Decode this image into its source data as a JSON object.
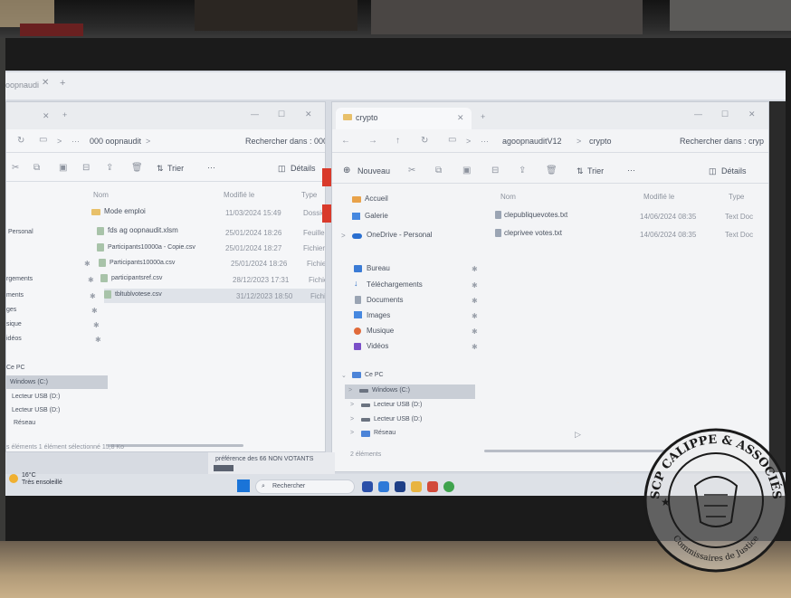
{
  "left_window": {
    "breadcrumb": {
      "ellipsis": "···",
      "folder": "000 oopnaudit",
      "chevron": ">"
    },
    "search_placeholder": "Rechercher dans : 000",
    "toolbar": {
      "sort": "Trier",
      "more": "···",
      "details": "Détails"
    },
    "columns": {
      "name": "Nom",
      "modified": "Modifié le",
      "type": "Type"
    },
    "files": [
      {
        "name": "Mode emploi",
        "modified": "11/03/2024 15:49",
        "type": "Dossier"
      },
      {
        "name": "fds ag oopnaudit.xlsm",
        "modified": "25/01/2024 18:26",
        "type": "Feuille d"
      },
      {
        "name": "Participants10000a - Copie.csv",
        "modified": "25/01/2024 18:27",
        "type": "Fichier C"
      },
      {
        "name": "Participants10000a.csv",
        "modified": "25/01/2024 18:26",
        "type": "Fichier C"
      },
      {
        "name": "participantsref.csv",
        "modified": "28/12/2023 17:31",
        "type": "Fichier C"
      },
      {
        "name": "tbltublvotese.csv",
        "modified": "31/12/2023 18:50",
        "type": "Fichier C"
      }
    ],
    "nav": [
      "Personal",
      "rgements",
      "ments",
      "ges",
      "sique",
      "idéos",
      "Ce PC",
      "Windows (C:)",
      "Lecteur USB (D:)",
      "Lecteur USB (D:)",
      "Réseau"
    ],
    "status": "s éléments    1 élément sélectionné  15,8 Ko"
  },
  "right_window": {
    "tab_title": "crypto",
    "breadcrumb": {
      "ellipsis": "···",
      "parent": "agoopnauditV12",
      "current": "crypto",
      "chevron": ">"
    },
    "search_placeholder": "Rechercher dans : cryp",
    "toolbar": {
      "new": "Nouveau",
      "sort": "Trier",
      "more": "···",
      "details": "Détails"
    },
    "columns": {
      "name": "Nom",
      "modified": "Modifié le",
      "type": "Type"
    },
    "files": [
      {
        "name": "clepubliquevotes.txt",
        "modified": "14/06/2024 08:35",
        "type": "Text Doc"
      },
      {
        "name": "cleprivee votes.txt",
        "modified": "14/06/2024 08:35",
        "type": "Text Doc"
      }
    ],
    "nav_top": [
      "Accueil",
      "Galerie",
      "OneDrive - Personal"
    ],
    "nav_quick": [
      "Bureau",
      "Téléchargements",
      "Documents",
      "Images",
      "Musique",
      "Vidéos"
    ],
    "nav_pc": [
      "Ce PC",
      "Windows (C:)",
      "Lecteur USB (D:)",
      "Lecteur USB (D:)",
      "Réseau"
    ],
    "status": "2 éléments"
  },
  "taskbar": {
    "weather_temp": "16°C",
    "weather_desc": "Très ensoleillé",
    "search_label": "Rechercher",
    "strip_text": "préférence des 66 NON VOTANTS",
    "back_tab": "oopnaudi"
  },
  "stamp": {
    "text_top": "SCP CALIPPE & ASSOCIÉS",
    "text_bottom": "Commissaires de Justice"
  },
  "colors": {
    "accent": "#2b6cc4",
    "stamp_ink": "#1a1a1a",
    "red_mark": "#d93a2b"
  }
}
